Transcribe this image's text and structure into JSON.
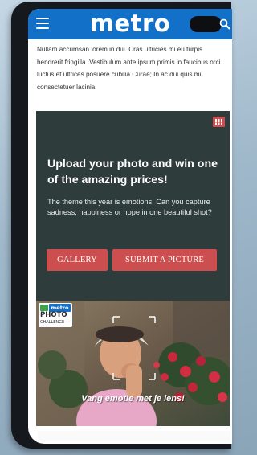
{
  "header": {
    "logo_text": "metro",
    "menu_icon": "hamburger-menu-icon",
    "search_icon": "search-icon",
    "bar_color": "#1370c8"
  },
  "article": {
    "paragraph": "Nullam accumsan lorem in dui. Cras ultricies mi eu turpis hendrerit fringilla. Vestibulum ante ipsum primis in faucibus orci luctus et ultrices posuere cubilia Curae; In ac dui quis mi consectetuer lacinia."
  },
  "promo": {
    "title": "Upload your photo and win one of the amazing prices!",
    "description": "The theme this year is emotions. Can you capture sadness, happiness or hope in one beautiful shot?",
    "gallery_label": "GALLERY",
    "submit_label": "SUBMIT A PICTURE",
    "menu_icon": "grid-menu-icon",
    "panel_color": "#2f3c3c",
    "button_color": "#cc4e4e"
  },
  "photo": {
    "brand_badge": "metro",
    "brand_photo": "PHOTO",
    "brand_challenge": "CHALLENGE",
    "caption": "Vang emotie met je lens!"
  }
}
